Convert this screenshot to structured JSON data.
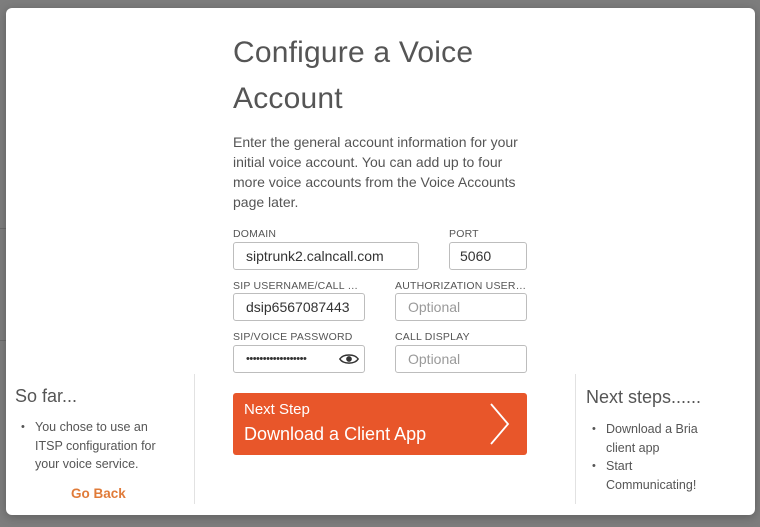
{
  "modal": {
    "title": "Configure a Voice Account",
    "description": "Enter the general account information for your initial voice account. You can add up to four more voice accounts from the Voice Accounts page later."
  },
  "form": {
    "domain": {
      "label": "DOMAIN",
      "value": "siptrunk2.calncall.com"
    },
    "port": {
      "label": "PORT",
      "value": "5060"
    },
    "sip_username": {
      "label": "SIP USERNAME/CALL EX...",
      "value": "dsip6567087443"
    },
    "auth_username": {
      "label": "AUTHORIZATION USERN...",
      "placeholder": "Optional"
    },
    "sip_password": {
      "label": "SIP/VOICE PASSWORD",
      "value": "••••••••••••••••••"
    },
    "call_display": {
      "label": "CALL DISPLAY",
      "placeholder": "Optional"
    }
  },
  "next_button": {
    "line1": "Next Step",
    "line2": "Download a Client App",
    "color": "#e8562a"
  },
  "so_far": {
    "title": "So far...",
    "items": [
      "You chose to use an ITSP configuration for your voice service."
    ],
    "go_back_label": "Go Back",
    "link_color": "#e07b39"
  },
  "next_steps": {
    "title": "Next steps......",
    "items": [
      "Download a Bria client app",
      "Start Communicating!"
    ]
  },
  "icons": {
    "password_toggle": "eye-icon",
    "next_arrow": "chevron-right-icon"
  }
}
